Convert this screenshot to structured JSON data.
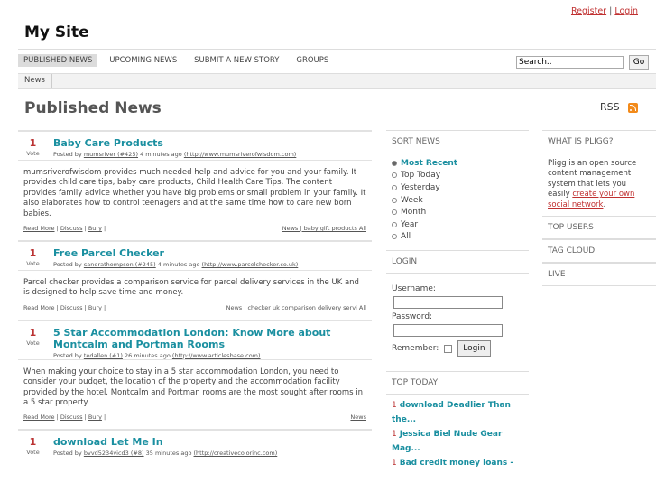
{
  "top_links": {
    "register": "Register",
    "separator": "|",
    "login": "Login"
  },
  "site_title": "My Site",
  "nav": {
    "items": [
      "PUBLISHED NEWS",
      "UPCOMING NEWS",
      "SUBMIT A NEW STORY",
      "GROUPS"
    ],
    "search_value": "Search..",
    "go_label": "Go"
  },
  "breadcrumb": {
    "item": "News"
  },
  "page_title": "Published News",
  "rss_label": "RSS",
  "stories": [
    {
      "votes": "1",
      "vote_label": "Vote",
      "title": "Baby Care Products",
      "posted_by": "Posted by",
      "user": "mumsriver (#425)",
      "time": "4 minutes ago",
      "url": "(http://www.mumsriverofwisdom.com)",
      "description": "mumsriverofwisdom provides much needed help and advice for you and your family. It provides child care tips, baby care products, Child Health Care Tips. The content provides family advice whether you have big problems or small problem in your family. It also elaborates how to control teenagers and at the same time how to care new born babies.",
      "read_more": "Read More",
      "discuss": "Discuss",
      "bury": "Bury",
      "tags": "News | baby gift products All"
    },
    {
      "votes": "1",
      "vote_label": "Vote",
      "title": "Free Parcel Checker",
      "posted_by": "Posted by",
      "user": "sandrathompson (#245)",
      "time": "4 minutes ago",
      "url": "(http://www.parcelchecker.co.uk)",
      "description": "Parcel checker provides a comparison service for parcel delivery services in the UK and is designed to help save time and money.",
      "read_more": "Read More",
      "discuss": "Discuss",
      "bury": "Bury",
      "tags": "News | checker uk comparison delivery servi All"
    },
    {
      "votes": "1",
      "vote_label": "Vote",
      "title": "5 Star Accommodation London: Know More about Montcalm and Portman Rooms",
      "posted_by": "Posted by",
      "user": "tedallen (#1)",
      "time": "26 minutes ago",
      "url": "(http://www.articlesbase.com)",
      "description": "When making your choice to stay in a 5 star accommodation London, you need to consider your budget, the location of the property and the accommodation facility provided by the hotel. Montcalm and Portman rooms are the most sought after rooms in a 5 star property.",
      "read_more": "Read More",
      "discuss": "Discuss",
      "bury": "Bury",
      "tags": "News"
    },
    {
      "votes": "1",
      "vote_label": "Vote",
      "title": "download Let Me In",
      "posted_by": "Posted by",
      "user": "bvvd5234vicd3 (#8)",
      "time": "35 minutes ago",
      "url": "(http://creativecolorinc.com)",
      "description": "",
      "read_more": "",
      "discuss": "",
      "bury": "",
      "tags": ""
    }
  ],
  "sort_news": {
    "heading": "SORT NEWS",
    "options": [
      "Most Recent",
      "Top Today",
      "Yesterday",
      "Week",
      "Month",
      "Year",
      "All"
    ],
    "selected": "Most Recent"
  },
  "login_box": {
    "heading": "LOGIN",
    "username_label": "Username:",
    "password_label": "Password:",
    "remember_label": "Remember:",
    "button": "Login"
  },
  "top_today": {
    "heading": "TOP TODAY",
    "items": [
      {
        "rank": "1",
        "title": "download Deadlier Than the..."
      },
      {
        "rank": "1",
        "title": "Jessica Biel Nude Gear Mag..."
      },
      {
        "rank": "1",
        "title": "Bad credit money loans -"
      }
    ]
  },
  "right_sidebar": {
    "what_is_heading": "WHAT IS PLIGG?",
    "what_is_text": "Pligg is an open source content management system that lets you easily",
    "what_is_link": "create your own social network",
    "what_is_end": ".",
    "sections": [
      "TOP USERS",
      "TAG CLOUD",
      "LIVE"
    ]
  },
  "colors": {
    "accent": "#1a8fa0",
    "vote": "#bb3333",
    "link_red": "#c03030",
    "rss": "#f28a1a"
  }
}
